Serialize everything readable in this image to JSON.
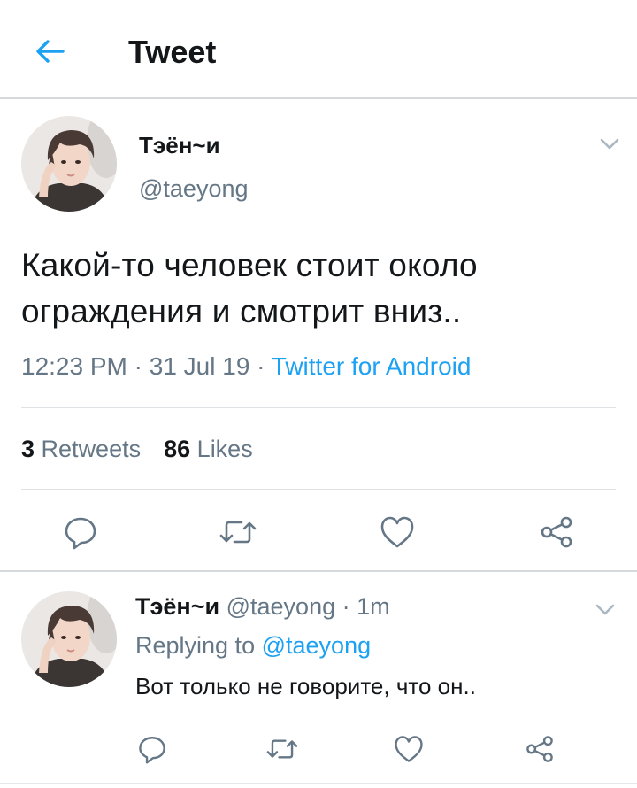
{
  "header": {
    "title": "Tweet",
    "back_icon": "back-arrow-icon"
  },
  "colors": {
    "accent": "#1da1f2",
    "text": "#14171a",
    "secondary": "#657786",
    "divider": "#dfe3e6"
  },
  "tweet": {
    "display_name": "Тэён~и",
    "handle": "@taeyong",
    "text": "Какой-то человек стоит около ограждения и смотрит вниз..",
    "time": "12:23 PM",
    "date": "31 Jul 19",
    "source": "Twitter for Android",
    "retweets_count": "3",
    "retweets_label": "Retweets",
    "likes_count": "86",
    "likes_label": "Likes",
    "actions": [
      "reply-icon",
      "retweet-icon",
      "like-icon",
      "share-icon"
    ]
  },
  "reply": {
    "display_name": "Тэён~и",
    "handle": "@taeyong",
    "time": "1m",
    "replying_prefix": "Replying to",
    "replying_to": "@taeyong",
    "text": "Вот только не говорите, что он..",
    "actions": [
      "reply-icon",
      "retweet-icon",
      "like-icon",
      "share-icon"
    ]
  }
}
